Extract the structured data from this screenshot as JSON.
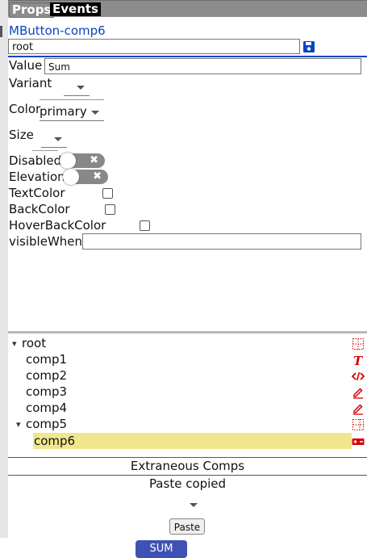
{
  "tabs": {
    "props": "Props",
    "events": "Events"
  },
  "component_title": "MButton-comp6",
  "root_field": {
    "value": "root"
  },
  "props": {
    "value_label": "Value",
    "value_input": "Sum",
    "variant_label": "Variant",
    "variant_value": "",
    "color_label": "Color",
    "color_value": "primary",
    "size_label": "Size",
    "size_value": "",
    "disabled_label": "Disabled",
    "elevation_label": "Elevation",
    "textcolor_label": "TextColor",
    "backcolor_label": "BackColor",
    "hoverbackcolor_label": "HoverBackColor",
    "visiblewhen_label": "visibleWhen",
    "visiblewhen_value": ""
  },
  "tree": {
    "root": "root",
    "items": [
      "comp1",
      "comp2",
      "comp3",
      "comp4",
      "comp5",
      "comp6"
    ]
  },
  "extraneous": {
    "title": "Extraneous Comps",
    "paste_copied": "Paste copied",
    "paste_button": "Paste"
  },
  "preview_button": "SUM",
  "colors": {
    "accent": "#0b44c4",
    "icon_red": "#d40000",
    "selected_row": "#f0e68c",
    "preview_btn": "#3f51b5"
  }
}
